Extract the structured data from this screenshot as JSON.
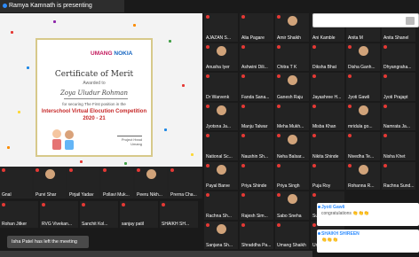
{
  "presenter": {
    "label": "Ramya Kamnath is presenting"
  },
  "certificate": {
    "logo_brand": "UMANG",
    "logo_partner": "NOKIA",
    "title": "Certificate of Merit",
    "awarded": "Awarded to",
    "name": "Zoya Uludur Rohman",
    "subtitle": "for securing The First position in the",
    "competition": "Interschool Virtual Elocution Competition",
    "year": "2020 - 21",
    "sign_title": "Project Head",
    "sign_org": "Umang"
  },
  "left_video_tiles": [
    {
      "name": "Gnal"
    },
    {
      "name": "Purvi Shar"
    },
    {
      "name": "Pirjail Yadav"
    },
    {
      "name": "Pollavi Muk..."
    },
    {
      "name": "Peeru Nikh..."
    },
    {
      "name": "Prerna Cha..."
    }
  ],
  "left_bottom_tiles": [
    {
      "name": "Rohan Jitker"
    },
    {
      "name": "RVG Vivekan..."
    },
    {
      "name": "Sanchit Kol..."
    },
    {
      "name": "sanjay patil"
    },
    {
      "name": "SHAIKH SH..."
    }
  ],
  "toast": {
    "text": "Isha Patel has left the meeting"
  },
  "participants": [
    {
      "name": "AJAZAN S..."
    },
    {
      "name": "Alia Pagare"
    },
    {
      "name": "Amir Shaikh"
    },
    {
      "name": "Ani Kamble"
    },
    {
      "name": "Anita M"
    },
    {
      "name": "Anita Shanel"
    },
    {
      "name": "Anusha Iyer"
    },
    {
      "name": "Ashwini Dili..."
    },
    {
      "name": "Chitra T K"
    },
    {
      "name": "Diksha Bhat"
    },
    {
      "name": "Disha Ganh..."
    },
    {
      "name": "Dhyangraha..."
    },
    {
      "name": "Dr Warvenk"
    },
    {
      "name": "Fanda Sana..."
    },
    {
      "name": "Ganesh Raju"
    },
    {
      "name": "Jayashree H..."
    },
    {
      "name": "Jyoti Gawli"
    },
    {
      "name": "Jyoti Prajapt"
    },
    {
      "name": "Jyotsna Ja..."
    },
    {
      "name": "Manju Talwar"
    },
    {
      "name": "Meha Mukh..."
    },
    {
      "name": "Misba Khan"
    },
    {
      "name": "mridula go..."
    },
    {
      "name": "Namrata Ja..."
    },
    {
      "name": "National Sc..."
    },
    {
      "name": "Naushin Sh..."
    },
    {
      "name": "Neha Balsar..."
    },
    {
      "name": "Nikita Shinde"
    },
    {
      "name": "Nivedha Te..."
    },
    {
      "name": "Nisha Khet"
    },
    {
      "name": "Payal Barve"
    },
    {
      "name": "Priya Shinde"
    },
    {
      "name": "Priya Singh"
    },
    {
      "name": "Puja Roy"
    },
    {
      "name": "Rohanna R..."
    },
    {
      "name": "Rachna Sund..."
    },
    {
      "name": "Rachna Sh..."
    },
    {
      "name": "Rajesh Sim..."
    },
    {
      "name": "Sabo Sneha"
    },
    {
      "name": "Sumaiya..."
    },
    {
      "name": "Shashi Ra..."
    },
    {
      "name": "Shivani N..."
    },
    {
      "name": "Sanjana Sh..."
    },
    {
      "name": "Shraddha Pa..."
    },
    {
      "name": "Umang Shaikh"
    },
    {
      "name": "Uma A"
    },
    {
      "name": "Vinayak S..."
    },
    {
      "name": "Yash A"
    }
  ],
  "chat": {
    "messages": [
      {
        "sender": "Jyoti Gawli",
        "text": "congratulations 👏👏👏"
      },
      {
        "sender": "SHAIKH SHIREEN",
        "text": "👏👏👏"
      }
    ]
  },
  "colors": {
    "accent": "#2d8cff",
    "tile_bg": "#232323",
    "cert_red": "#c62828"
  }
}
